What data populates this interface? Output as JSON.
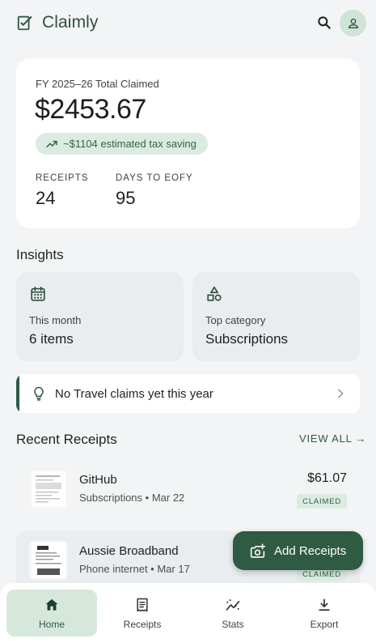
{
  "app": {
    "name": "Claimly"
  },
  "summary": {
    "fy_label": "FY 2025–26 Total Claimed",
    "total": "$2453.67",
    "saving": "~$1104 estimated tax saving",
    "receipts_label": "RECEIPTS",
    "receipts_value": "24",
    "days_label": "DAYS TO EOFY",
    "days_value": "95"
  },
  "insights": {
    "title": "Insights",
    "cards": [
      {
        "icon": "calendar-icon",
        "caption": "This month",
        "value": "6 items"
      },
      {
        "icon": "category-icon",
        "caption": "Top category",
        "value": "Subscriptions"
      }
    ],
    "tip": "No Travel claims yet this year"
  },
  "recent": {
    "title": "Recent Receipts",
    "view_all": "VIEW ALL →",
    "items": [
      {
        "merchant": "GitHub",
        "meta": "Subscriptions • Mar 22",
        "amount": "$61.07",
        "status": "CLAIMED"
      },
      {
        "merchant": "Aussie Broadband",
        "meta": "Phone internet • Mar 17",
        "amount": "",
        "status": "CLAIMED"
      }
    ]
  },
  "fab": {
    "label": "Add Receipts"
  },
  "nav": {
    "items": [
      {
        "label": "Home",
        "icon": "home-icon"
      },
      {
        "label": "Receipts",
        "icon": "receipt-icon"
      },
      {
        "label": "Stats",
        "icon": "stats-icon"
      },
      {
        "label": "Export",
        "icon": "download-icon"
      }
    ]
  },
  "colors": {
    "accent": "#2f5a44",
    "accent_light": "#dcebe1",
    "background": "#f3f4f5",
    "card_tint": "#e9edef"
  }
}
